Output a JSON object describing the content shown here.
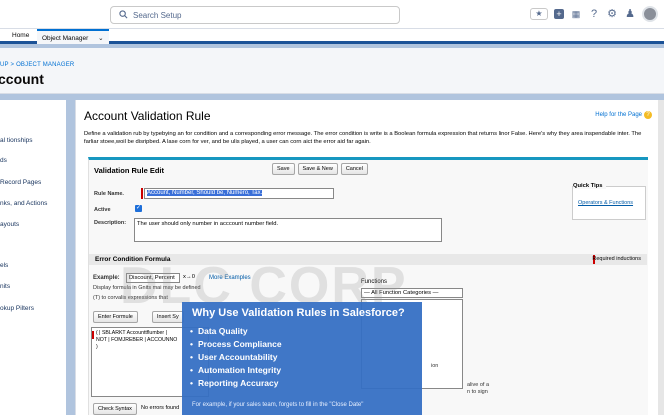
{
  "topbar": {
    "search_placeholder": "Search Setup",
    "icons": [
      "star-icon",
      "add-icon",
      "app-launcher-icon",
      "help-icon",
      "gear-icon",
      "bell-icon",
      "avatar"
    ]
  },
  "navbar": {
    "home": "Home",
    "object_manager": "Object Manager",
    "chevron": "⌄"
  },
  "header": {
    "breadcrumb": "SETUP > OBJECT MANAGER",
    "breadcrumb_visible": "UP > OBJECT MANAGER",
    "title": "ccount"
  },
  "sidebar": {
    "items": [
      "al tionships",
      "ds",
      "Record Pages",
      "nks, and Actions",
      "ayouts",
      "els",
      "nits",
      "okup Pilters"
    ]
  },
  "main": {
    "title": "Account Validation Rule",
    "help_link": "Help for the Page",
    "description": "Define a validation rub by typebying an for condition and a corresponding error message.  The error condition is write is a Boolean formula expression that returns linor False.  Here's why they area inspendable inter. The farliar stoee,woil be disripbed.  A lase corn for ver, and be ulis played, a user can corn aict the error aid far again."
  },
  "edit": {
    "title": "Validation Rule Edit",
    "save": "Save",
    "save_new": "Save & New",
    "cancel": "Cancel",
    "rule_name_label": "Rule Name.",
    "rule_name_value": "Account, Number, Should be, Numero, Tax.",
    "active_label": "Active",
    "description_label": "Description:",
    "description_value": "The user should only number in acccount number field.",
    "quick_tips_title": "Quick Tips",
    "quick_tips_link": "Operators & Functions"
  },
  "formula_section": {
    "title": "Error Condition Formula",
    "required": "Required inductions",
    "example_label": "Example:",
    "example_value": "Discount, Percent",
    "example_op": "x→0",
    "more_examples": "More Examples",
    "hint1": "Display formula in  Gnits mai may be defined",
    "hint2": "(T) to corvalis expressions that ",
    "enter_formula": "Enter Formule",
    "insert": "Insert Sy",
    "formula_text": [
      "( | SBLARKT Accounttflumber |",
      "NOT | FOMJREBER | ACCOUNNO",
      ")"
    ],
    "functions_label": "Functions",
    "function_category": "— All Function Categories —",
    "check_syntax": "Check Syntax",
    "no_errors": "No errors found",
    "right_hint1": "ion",
    "right_hint2": "alive of a",
    "right_hint3": "n to sign"
  },
  "watermark": "DLC CORP",
  "overlay": {
    "title": "Why Use Validation Rules in Salesforce?",
    "items": [
      "Data Quality",
      "Process Compliance",
      "User Accountability",
      "Automation Integrity",
      "Reporting Accuracy"
    ],
    "footer": "For example, if your sales team, forgets to fill in the \"Close Date\""
  }
}
